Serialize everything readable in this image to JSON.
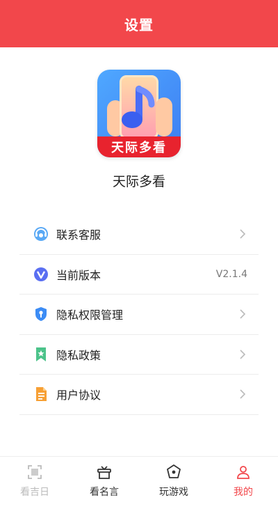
{
  "header": {
    "title": "设置"
  },
  "app": {
    "name": "天际多看",
    "logo_text": "天际多看"
  },
  "menu": {
    "items": [
      {
        "label": "联系客服",
        "icon": "customer-service-icon",
        "value": ""
      },
      {
        "label": "当前版本",
        "icon": "version-icon",
        "value": "V2.1.4"
      },
      {
        "label": "隐私权限管理",
        "icon": "privacy-shield-icon",
        "value": ""
      },
      {
        "label": "隐私政策",
        "icon": "bookmark-star-icon",
        "value": ""
      },
      {
        "label": "用户协议",
        "icon": "document-icon",
        "value": ""
      }
    ]
  },
  "tabbar": {
    "tabs": [
      {
        "label": "看吉日",
        "icon": "scan-icon",
        "state": "dim"
      },
      {
        "label": "看名言",
        "icon": "gift-box-icon",
        "state": "normal"
      },
      {
        "label": "玩游戏",
        "icon": "game-icon",
        "state": "normal"
      },
      {
        "label": "我的",
        "icon": "profile-icon",
        "state": "active"
      }
    ]
  },
  "colors": {
    "accent": "#f2474b",
    "divider": "#ececec",
    "text": "#222222",
    "muted": "#777777"
  }
}
